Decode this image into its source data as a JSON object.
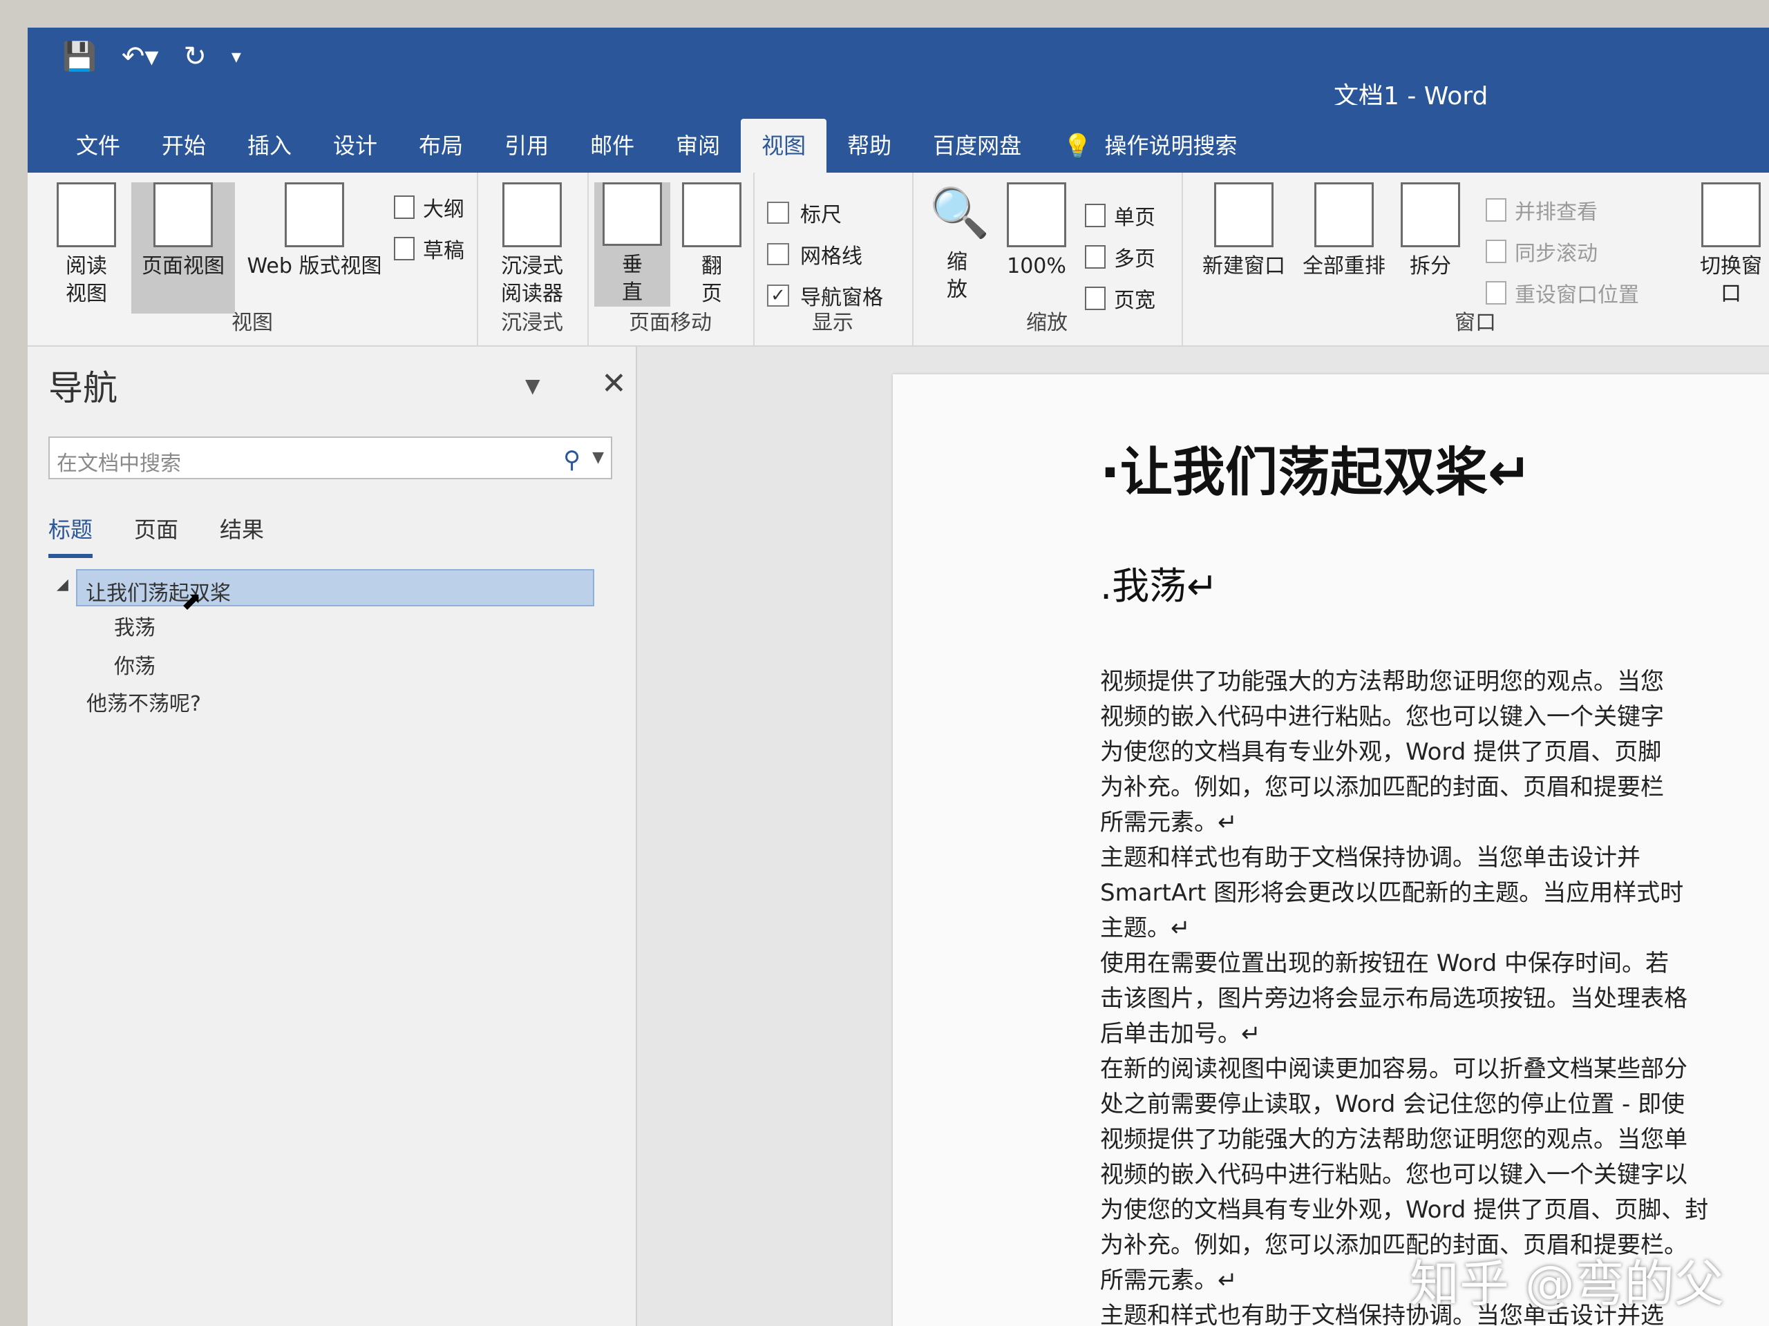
{
  "titlebar": {
    "title": "文档1  -  Word"
  },
  "qat": {
    "save_icon": "save-icon",
    "undo_icon": "undo-icon",
    "redo_icon": "redo-icon",
    "more_icon": "customize-icon"
  },
  "tabs": [
    "文件",
    "开始",
    "插入",
    "设计",
    "布局",
    "引用",
    "邮件",
    "审阅",
    "视图",
    "帮助",
    "百度网盘"
  ],
  "tell_me": "操作说明搜索",
  "ribbon": {
    "views": {
      "read": "阅读\n视图",
      "print": "页面视图",
      "web": "Web 版式视图",
      "outline": "大纲",
      "draft": "草稿",
      "label": "视图"
    },
    "immersive": {
      "reader": "沉浸式\n阅读器",
      "label": "沉浸式"
    },
    "page_move": {
      "vertical": "垂\n直",
      "flip": "翻\n页",
      "label": "页面移动"
    },
    "show": {
      "ruler": "标尺",
      "gridlines": "网格线",
      "nav_pane": "导航窗格",
      "label": "显示",
      "ruler_checked": false,
      "gridlines_checked": false,
      "nav_checked": true
    },
    "zoom": {
      "zoom": "缩\n放",
      "hundred": "100%",
      "one_page": "单页",
      "multi_page": "多页",
      "page_width": "页宽",
      "label": "缩放"
    },
    "window": {
      "new_window": "新建窗口",
      "arrange_all": "全部重排",
      "split": "拆分",
      "side_by_side": "并排查看",
      "sync_scroll": "同步滚动",
      "reset_pos": "重设窗口位置",
      "switch": "切换窗口",
      "label": "窗口"
    }
  },
  "nav": {
    "title": "导航",
    "search_placeholder": "在文档中搜索",
    "tabs": [
      "标题",
      "页面",
      "结果"
    ],
    "headings": [
      "让我们荡起双桨",
      "我荡",
      "你荡",
      "他荡不荡呢?"
    ]
  },
  "document": {
    "h1": "·让我们荡起双桨↵",
    "h2": ".我荡↵",
    "lines": [
      "视频提供了功能强大的方法帮助您证明您的观点。当您",
      "视频的嵌入代码中进行粘贴。您也可以键入一个关键字",
      "为使您的文档具有专业外观，Word 提供了页眉、页脚",
      "为补充。例如，您可以添加匹配的封面、页眉和提要栏",
      "所需元素。↵",
      "主题和样式也有助于文档保持协调。当您单击设计并",
      "SmartArt 图形将会更改以匹配新的主题。当应用样式时",
      "主题。↵",
      "使用在需要位置出现的新按钮在 Word 中保存时间。若",
      "击该图片，图片旁边将会显示布局选项按钮。当处理表格",
      "后单击加号。↵",
      "在新的阅读视图中阅读更加容易。可以折叠文档某些部分",
      "处之前需要停止读取，Word 会记住您的停止位置 - 即使",
      "视频提供了功能强大的方法帮助您证明您的观点。当您单",
      "视频的嵌入代码中进行粘贴。您也可以键入一个关键字以",
      "为使您的文档具有专业外观，Word 提供了页眉、页脚、封",
      "为补充。例如，您可以添加匹配的封面、页眉和提要栏。",
      "所需元素。↵",
      "主题和样式也有助于文档保持协调。当您单击设计并选"
    ]
  },
  "watermark": "知乎 @弯的父"
}
